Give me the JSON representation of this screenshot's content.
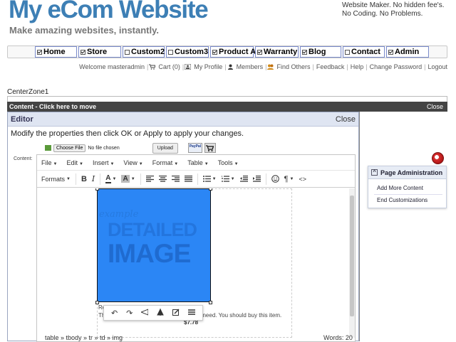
{
  "header": {
    "site_title": "My eCom Website",
    "tagline": "Make amazing websites, instantly.",
    "promo": "Website Maker. No hidden fee's. No Coding. No Problems."
  },
  "nav": {
    "items": [
      {
        "label": "Home",
        "checked": true
      },
      {
        "label": "Store",
        "checked": true
      },
      {
        "label": "Custom2",
        "checked": false
      },
      {
        "label": "Custom3",
        "checked": false
      },
      {
        "label": "Product A",
        "checked": true
      },
      {
        "label": "Warranty",
        "checked": true
      },
      {
        "label": "Blog",
        "checked": true
      },
      {
        "label": "Contact",
        "checked": false
      },
      {
        "label": "Admin",
        "checked": true
      }
    ]
  },
  "user_links": {
    "welcome": "Welcome masteradmin",
    "cart": "Cart (0)",
    "profile": "My Profile",
    "members": "Members",
    "find_others": "Find Others",
    "feedback": "Feedback",
    "help": "Help",
    "change_password": "Change Password",
    "logout": "Logout"
  },
  "zone": {
    "label": "CenterZone1",
    "content_bar": "Content - Click here to move",
    "close": "Close"
  },
  "editor": {
    "title": "Editor",
    "close": "Close",
    "instruction": "Modify the properties then click OK or Apply to apply your changes.",
    "content_label": "Content:",
    "choose_file": "Choose File",
    "no_file": "No file chosen",
    "upload": "Upload",
    "paypal": "PayPal",
    "menus": [
      "File",
      "Edit",
      "Insert",
      "View",
      "Format",
      "Table",
      "Tools"
    ],
    "formats": "Formats",
    "image_text": [
      "example",
      "DETAILED",
      "IMAGE"
    ],
    "description_visible": "Re",
    "description_line2": "Th",
    "description_tail": "ou need. You should buy this item.",
    "price": "$7.78",
    "path": "table » tbody » tr » td » img",
    "words": "Words: 20"
  },
  "admin": {
    "title": "Page Administration",
    "items": [
      "Add More Content",
      "End Customizations"
    ]
  },
  "icons": [
    "shopping-cart-icon",
    "user-icon",
    "members-icon",
    "find-others-icon",
    "paypal-icon",
    "bold-icon",
    "italic-icon",
    "align-left-icon",
    "emoji-icon",
    "pilcrow-icon",
    "code-icon",
    "undo-icon",
    "redo-icon",
    "flip-horizontal-icon",
    "flip-vertical-icon",
    "edit-image-icon",
    "image-options-icon",
    "admin-orb-icon"
  ],
  "colors": {
    "title": "#3d7fb5",
    "image": "#2b86f5",
    "content_bar": "#444444",
    "editor_header": "#dfe5f2"
  }
}
